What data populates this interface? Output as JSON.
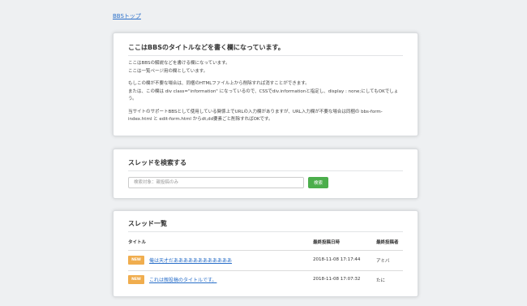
{
  "nav": {
    "top_link": "BBSトップ"
  },
  "info": {
    "title": "ここはBBSのタイトルなどを書く欄になっています。",
    "para1_line1": "ここはBBSの解説などを書ける欄になっています。",
    "para1_line2": "ここは一覧ページ用の欄としています。",
    "para2_line1": "もしこの欄が不要な場合は、同梱のHTMLファイル上から削除すれば消すことができます。",
    "para2_line2": "または、この欄は div class=\"information\" になっているので、CSSでdiv.informationと指定し、display : none;にしてもOKでしょう。",
    "para3": "当サイトのサポートBBSとして使用している関係上でURLの入力欄がありますが、URL入力欄が不要な場合は同梱の bbs-form-index.html と edit-form.html からdt,dd要素ごと削除すればOKです。"
  },
  "search": {
    "title": "スレッドを検索する",
    "placeholder": "検索対象：親投稿のみ",
    "value": "",
    "button_label": "検索"
  },
  "threads": {
    "title": "スレッド一覧",
    "columns": {
      "title": "タイトル",
      "last_posted": "最終投稿日時",
      "last_poster": "最終投稿者"
    },
    "rows": [
      {
        "badge": "NEW",
        "title": "俺は天才だああああああああああああ",
        "last_posted": "2018-11-08 17:17:44",
        "last_poster": "アミバ"
      },
      {
        "badge": "NEW",
        "title": "これは親投稿のタイトルです。",
        "last_posted": "2018-11-08 17:07:32",
        "last_poster": "たに"
      }
    ]
  },
  "colors": {
    "link": "#2a6fc9",
    "badge": "#f0ad4e",
    "search_button": "#4cae4c",
    "background": "#eef0f2"
  }
}
